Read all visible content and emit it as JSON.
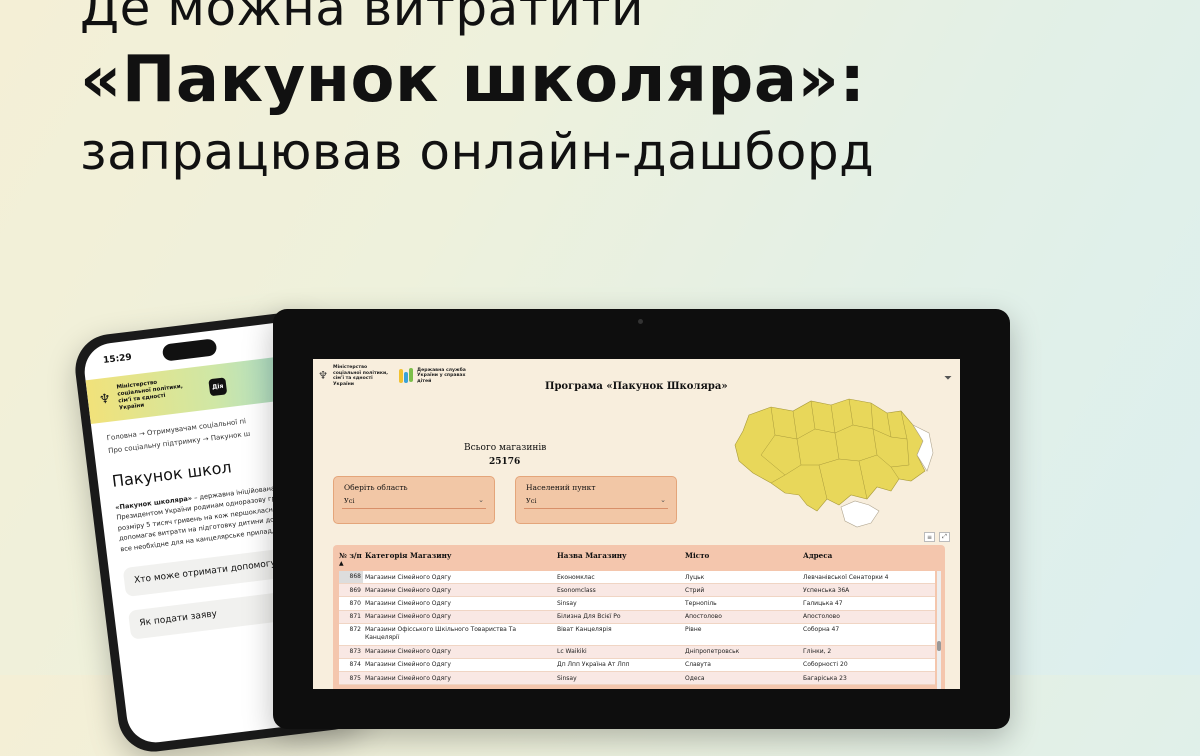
{
  "headline": {
    "line1": "Де можна витратити",
    "line2": "«Пакунок школяра»:",
    "line3": "запрацював онлайн-дашборд"
  },
  "phone": {
    "time": "15:29",
    "banner_org": "Міністерство соціальної політики, сім'ї та єдності України",
    "diia": "Дія",
    "breadcrumb_1": "Головна → Отримувачам соціальної пі",
    "breadcrumb_2": "Про соціальну підтримку → Пакунок ш",
    "title": "Пакунок школ",
    "para_bold": "«Пакунок школяра»",
    "para_rest": " – державна ініційована Президентом України родинам одноразову грошову до розміру 5 тисяч гривень на кож першокласника. Вона допомагає витрати на підготовку дитини до придбати все необхідне для на канцелярське приладдя, одяг і",
    "accordion_1": "Хто може отримати допомогу",
    "accordion_2": "Як подати заяву"
  },
  "dashboard": {
    "logo_ministry": "Міністерство соціальної політики, сім'ї та єдності України",
    "logo_agency": "Державна служба України у справах дітей",
    "title": "Програма «Пакунок Школяра»",
    "kpi_label": "Всього магазинів",
    "kpi_value": "25176",
    "slicer_region": {
      "label": "Оберіть область",
      "value": "Усі"
    },
    "slicer_city": {
      "label": "Населений пункт",
      "value": "Усі"
    },
    "columns": {
      "num": "№ з/п",
      "category": "Категорія Магазину",
      "name": "Назва Магазину",
      "city": "Місто",
      "address": "Адреса"
    },
    "rows": [
      {
        "n": "868",
        "category": "Магазини Сімейного Одягу",
        "name": "Економклас",
        "city": "Луцьк",
        "address": "Левчанівської Сенаторки 4"
      },
      {
        "n": "869",
        "category": "Магазини Сімейного Одягу",
        "name": "Esonomclass",
        "city": "Стрий",
        "address": "Успенська 36А"
      },
      {
        "n": "870",
        "category": "Магазини Сімейного Одягу",
        "name": "Sinsay",
        "city": "Тернопіль",
        "address": "Галицька 47"
      },
      {
        "n": "871",
        "category": "Магазини Сімейного Одягу",
        "name": "Білизна Для Всієї Ро",
        "city": "Апостолово",
        "address": "Апостолово"
      },
      {
        "n": "872",
        "category": "Магазини Офісського Шкільного Товариства Та",
        "category2": "Канцелярії",
        "name": "Віват Канцелярія",
        "city": "Рівне",
        "address": "Соборна 47"
      },
      {
        "n": "873",
        "category": "Магазини Сімейного Одягу",
        "name": "Lc Waikiki",
        "city": "Дніпропетровськ",
        "address": "Глінки, 2"
      },
      {
        "n": "874",
        "category": "Магазини Сімейного Одягу",
        "name": "Дп Лпп Україна Ат Лпп",
        "city": "Славута",
        "address": "Соборності 20"
      },
      {
        "n": "875",
        "category": "Магазини Сімейного Одягу",
        "name": "Sinsay",
        "city": "Одеса",
        "address": "Багаріська 23"
      }
    ]
  }
}
